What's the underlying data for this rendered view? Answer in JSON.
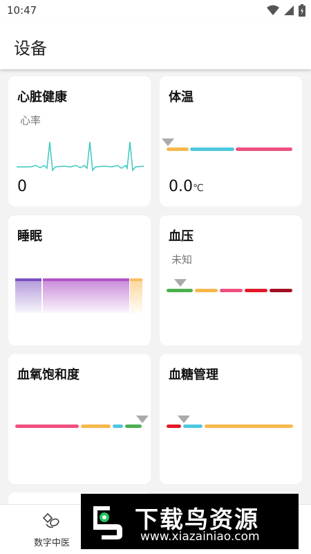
{
  "status": {
    "time": "10:47"
  },
  "appbar": {
    "title": "设备"
  },
  "cards": {
    "heart": {
      "title": "心脏健康",
      "subtitle": "心率",
      "value": "0"
    },
    "temperature": {
      "title": "体温",
      "value": "0.0",
      "unit": "℃"
    },
    "sleep": {
      "title": "睡眠"
    },
    "blood_pressure": {
      "title": "血压",
      "subtitle": "未知"
    },
    "spo2": {
      "title": "血氧饱和度"
    },
    "glucose": {
      "title": "血糖管理"
    }
  },
  "bottomnav": {
    "item_label": "数字中医",
    "icon": "tcm-icon"
  },
  "watermark": {
    "title": "下载鸟资源",
    "url": "www.xiazainiao.com"
  },
  "colors": {
    "orange": "#f7b84b",
    "cyan": "#4ec8e0",
    "pink": "#ef5080",
    "green": "#4caf50",
    "red": "#e01a2a",
    "darkred": "#a01020",
    "ecg": "#3cc8bd",
    "sleep_deep": "#7b4fc0",
    "sleep_light": "#b054c8",
    "sleep_awake": "#f8c060",
    "pointer": "#aaaaaa"
  }
}
